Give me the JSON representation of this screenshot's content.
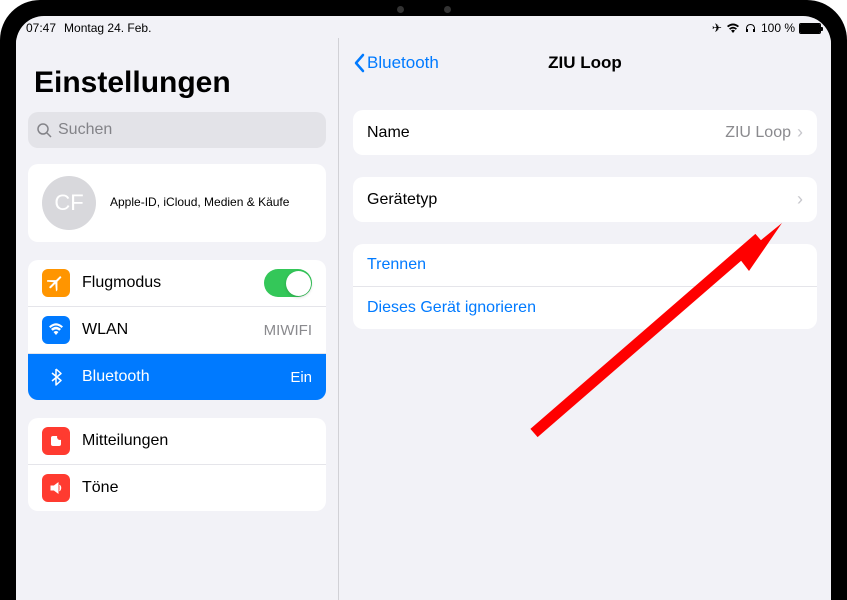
{
  "status": {
    "time": "07:47",
    "date": "Montag 24. Feb.",
    "battery_percent": "100 %"
  },
  "sidebar": {
    "title": "Einstellungen",
    "search_placeholder": "Suchen",
    "profile": {
      "initials": "CF",
      "subtitle": "Apple-ID, iCloud, Medien & Käufe"
    },
    "group1": {
      "airplane": "Flugmodus",
      "wlan_label": "WLAN",
      "wlan_value": "MIWIFI",
      "bluetooth_label": "Bluetooth",
      "bluetooth_value": "Ein"
    },
    "group2": {
      "notifications": "Mitteilungen",
      "sounds": "Töne"
    }
  },
  "detail": {
    "back": "Bluetooth",
    "title": "ZIU Loop",
    "name_label": "Name",
    "name_value": "ZIU Loop",
    "device_type": "Gerätetyp",
    "disconnect": "Trennen",
    "forget": "Dieses Gerät ignorieren"
  }
}
